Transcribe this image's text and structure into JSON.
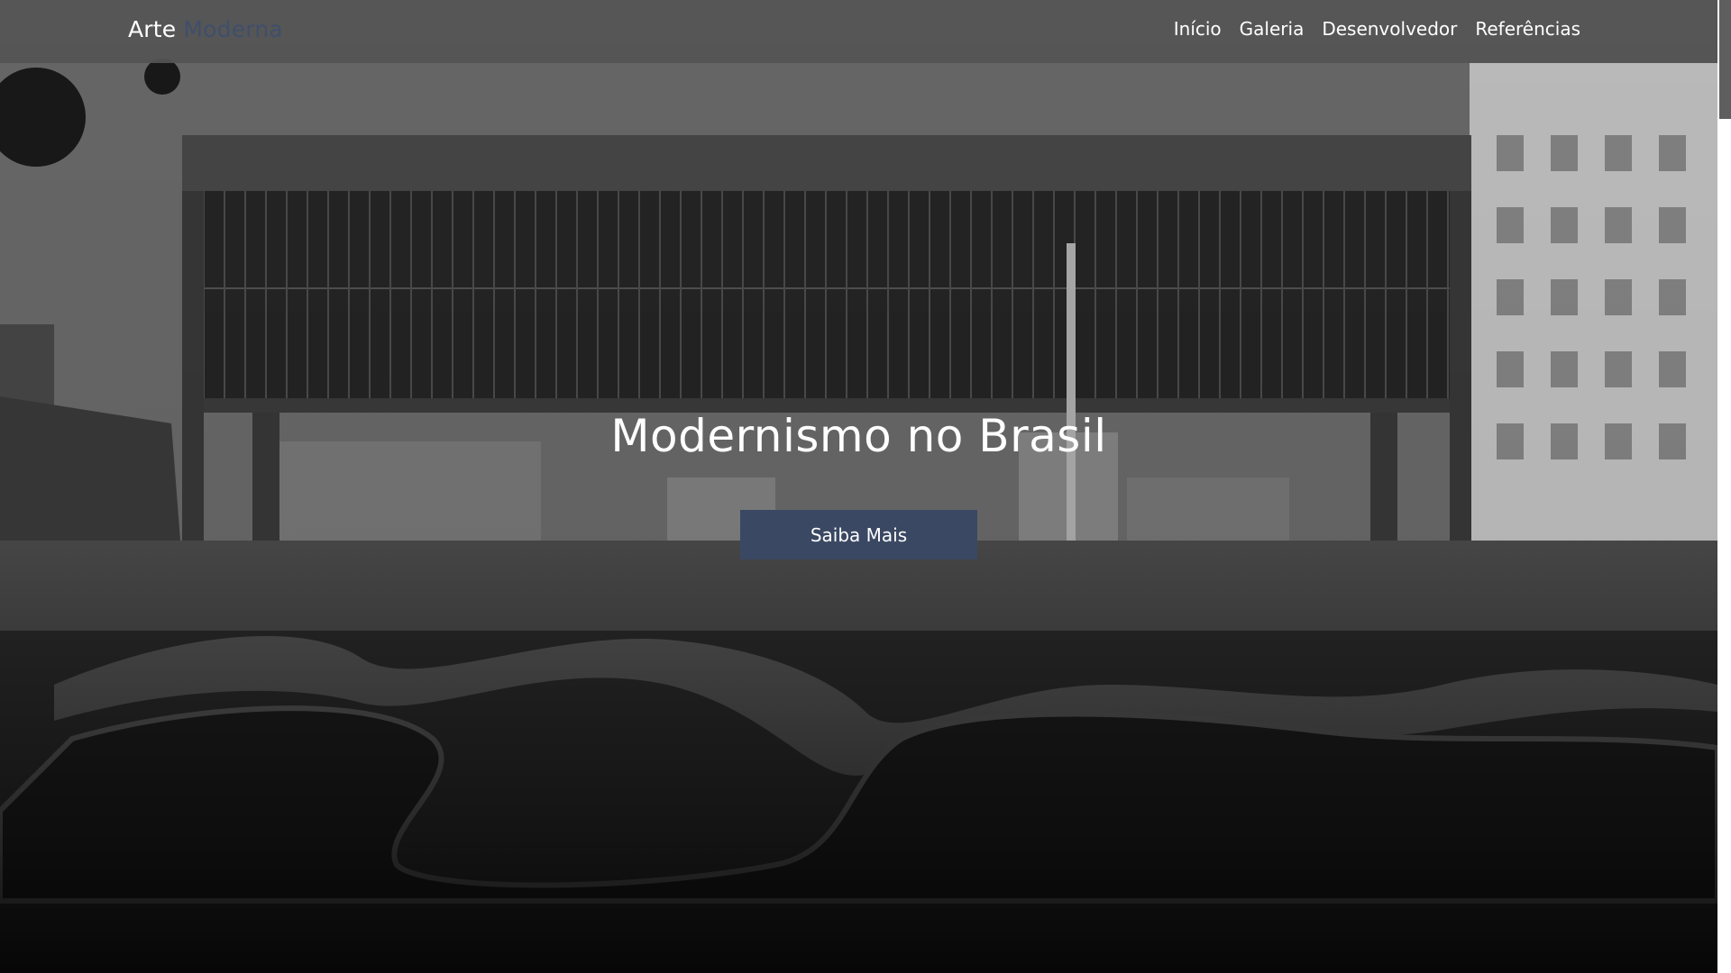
{
  "navbar": {
    "brand": {
      "part1": "Arte",
      "part2": "Moderna"
    },
    "links": [
      {
        "label": "Início"
      },
      {
        "label": "Galeria"
      },
      {
        "label": "Desenvolvedor"
      },
      {
        "label": "Referências"
      }
    ]
  },
  "hero": {
    "title": "Modernismo no Brasil",
    "cta_label": "Saiba Mais",
    "background": "grayscale photo of modernist museum building suspended over plaza with curved reflecting pools"
  },
  "colors": {
    "navbar_bg": "#555555",
    "brand_primary": "#ffffff",
    "brand_accent": "#3f4f6b",
    "button_bg": "#3a4863",
    "text": "#ffffff"
  }
}
